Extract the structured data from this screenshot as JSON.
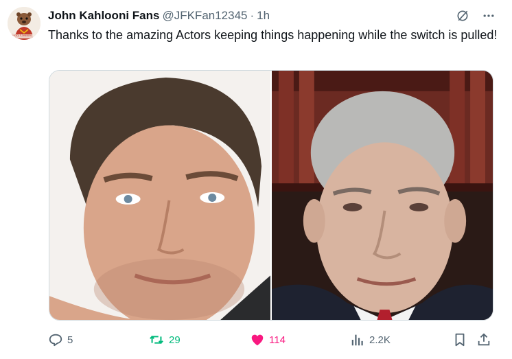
{
  "author": {
    "name": "John Kahlooni Fans",
    "handle": "@JFKFan12345",
    "separator": "·",
    "time": "1h",
    "avatar_caption": "Story Creators"
  },
  "tweet": {
    "text": "Thanks to the amazing Actors keeping things happening while the switch is pulled!"
  },
  "media": {
    "images": [
      {
        "subject": "man-portrait-left"
      },
      {
        "subject": "man-portrait-right"
      }
    ]
  },
  "stats": {
    "replies": "5",
    "retweets": "29",
    "likes": "114",
    "views": "2.2K"
  },
  "colors": {
    "text": "#0f1419",
    "secondary": "#536471",
    "retweet_active": "#00ba7c",
    "like_active": "#f91880",
    "border": "#cfd9de"
  },
  "icons": {
    "grok": "grok-icon",
    "more": "more-icon",
    "reply": "reply-icon",
    "retweet": "retweet-icon",
    "like": "heart-icon",
    "views": "views-icon",
    "bookmark": "bookmark-icon",
    "share": "share-icon"
  }
}
